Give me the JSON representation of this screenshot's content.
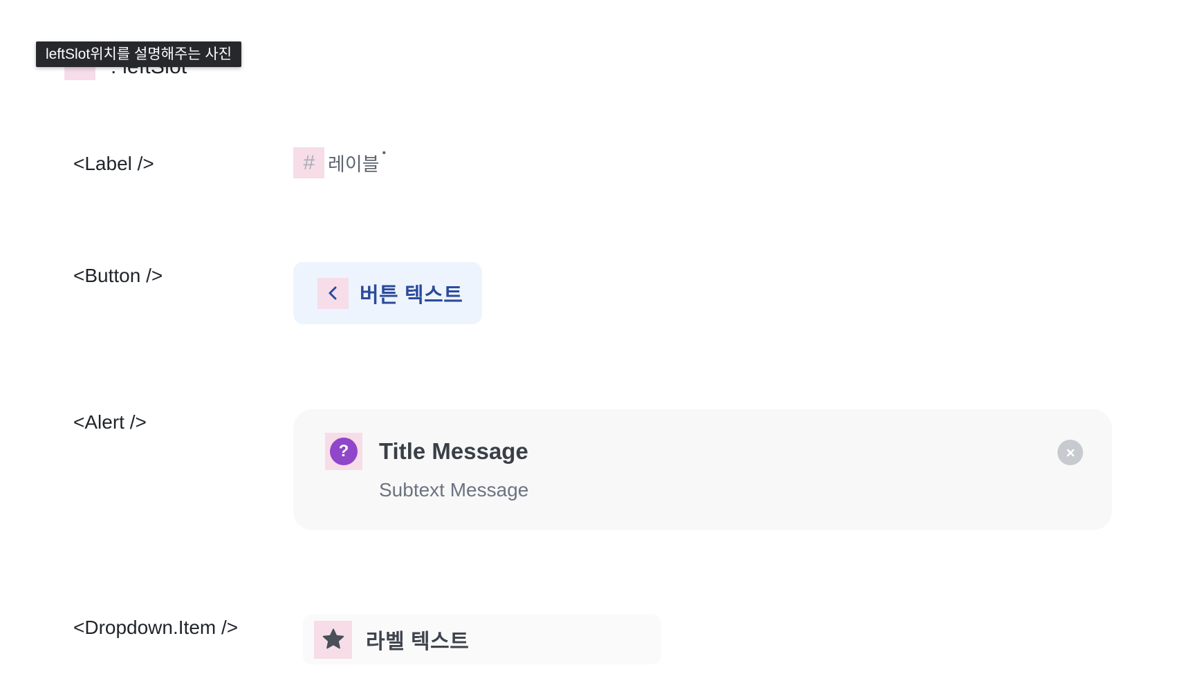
{
  "tooltip": {
    "text": "leftSlot위치를 설명해주는 사진"
  },
  "legend": {
    "text": ": leftSlot",
    "slot_color": "#f6dde7"
  },
  "rows": {
    "label": {
      "name": "<Label />",
      "sample_text": "레이블",
      "required_mark": "•",
      "icon": "hash-icon"
    },
    "button": {
      "name": "<Button />",
      "sample_text": "버튼 텍스트",
      "icon": "chevron-left-icon"
    },
    "alert": {
      "name": "<Alert />",
      "title": "Title Message",
      "subtext": "Subtext Message",
      "icon": "question-icon",
      "close_icon": "close-icon"
    },
    "dropdown_item": {
      "name": "<Dropdown.Item />",
      "sample_text": "라벨 텍스트",
      "icon": "star-icon"
    }
  },
  "colors": {
    "slot_highlight": "#f6dde7",
    "button_bg": "#eef4fd",
    "button_text": "#2a4a9c",
    "alert_bg": "#f8f8f9",
    "question_icon": "#8f46c9"
  }
}
